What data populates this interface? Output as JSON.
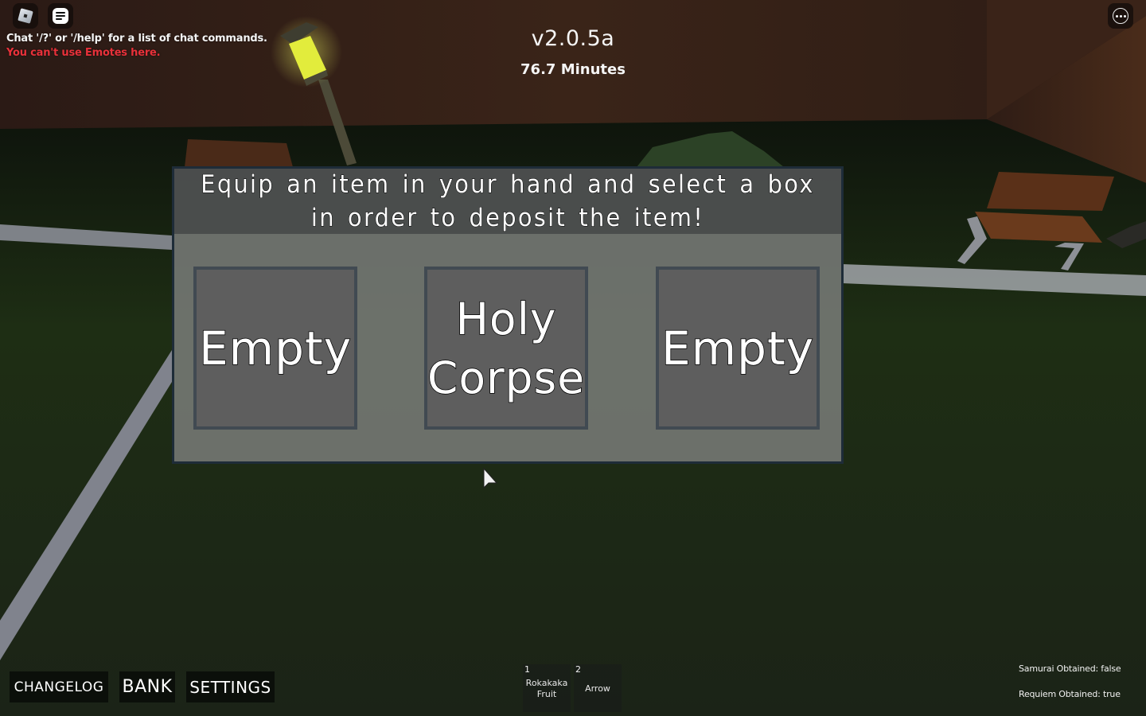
{
  "topbar": {
    "roblox_icon": "roblox-logo-icon",
    "chat_icon": "chat-icon",
    "menu_icon": "more-options-icon"
  },
  "chat": {
    "system_message": "Chat '/?' or '/help' for a list of chat commands.",
    "error_message": "You can't use Emotes here.",
    "error_color": "#e8313a"
  },
  "hud": {
    "version": "v2.0.5a",
    "play_time": "76.7 Minutes"
  },
  "bank_panel": {
    "instruction": "Equip an item in your hand and select a box in order to deposit the item!",
    "slots": [
      {
        "label": "Empty"
      },
      {
        "label": "Holy\nCorpse"
      },
      {
        "label": "Empty"
      }
    ]
  },
  "menu_buttons": {
    "changelog": "CHANGELOG",
    "bank": "BANK",
    "settings": "SETTINGS"
  },
  "hotbar": [
    {
      "key": "1",
      "item": "Rokakaka\nFruit"
    },
    {
      "key": "2",
      "item": "Arrow"
    }
  ],
  "status": {
    "samurai": "Samurai Obtained: false",
    "requiem": "Requiem Obtained: true"
  }
}
